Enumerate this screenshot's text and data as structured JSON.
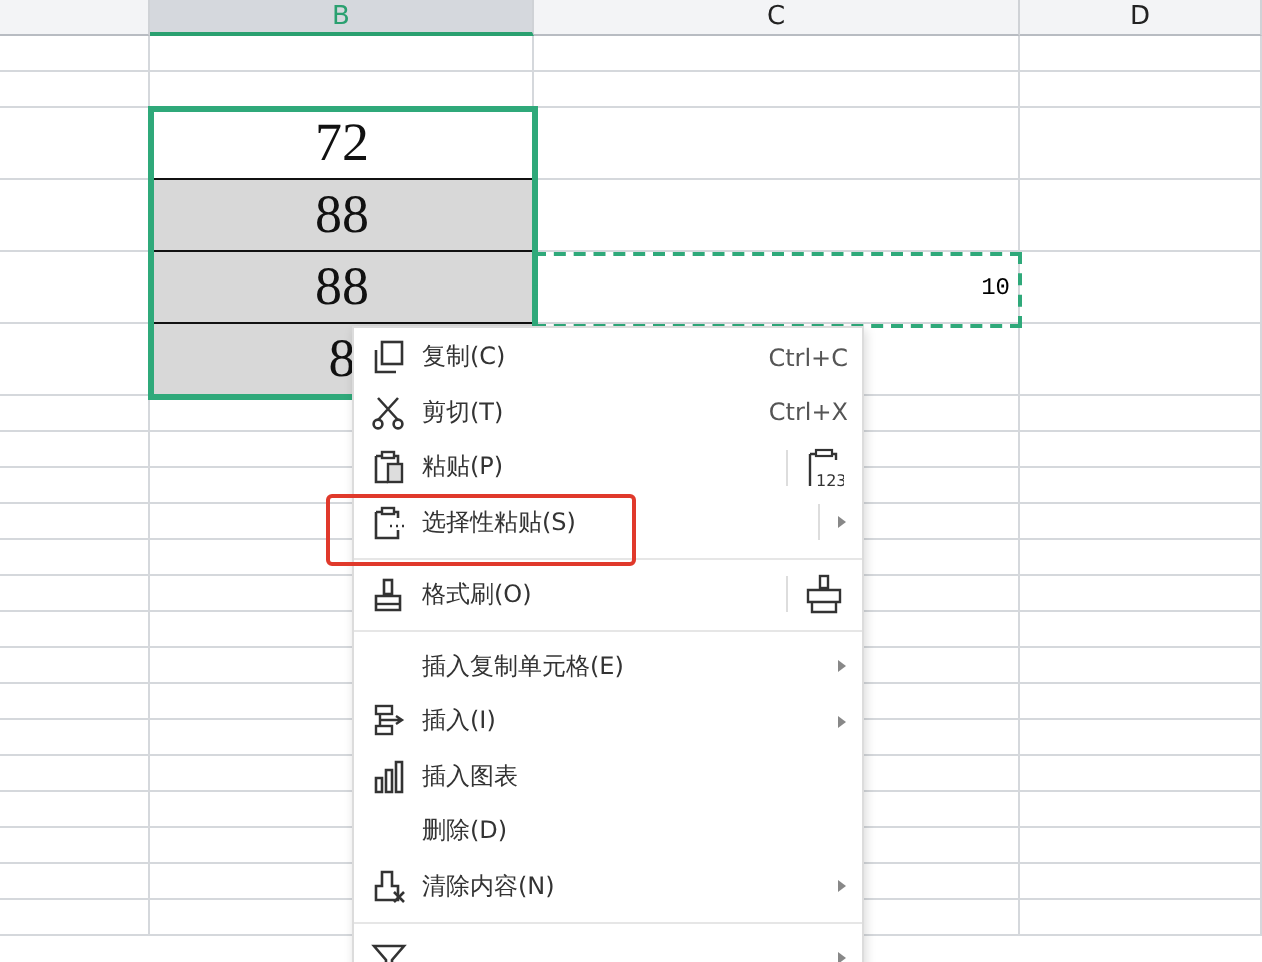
{
  "columns": [
    {
      "label": "B",
      "selected": true
    },
    {
      "label": "C",
      "selected": false
    },
    {
      "label": "D",
      "selected": false
    }
  ],
  "cells": [
    {
      "value": "72",
      "shaded": false
    },
    {
      "value": "88",
      "shaded": true
    },
    {
      "value": "88",
      "shaded": true
    },
    {
      "value": "8",
      "shaded": true
    }
  ],
  "copied_cell": {
    "value": "10"
  },
  "context_menu": {
    "items": [
      {
        "kind": "command",
        "label": "复制(C)",
        "shortcut": "Ctrl+C"
      },
      {
        "kind": "command",
        "label": "剪切(T)",
        "shortcut": "Ctrl+X"
      },
      {
        "kind": "split",
        "label": "粘贴(P)",
        "side_text": "123"
      },
      {
        "kind": "split-submenu",
        "label": "选择性粘贴(S)",
        "annotated": true
      },
      {
        "kind": "separator"
      },
      {
        "kind": "split",
        "label": "格式刷(O)"
      },
      {
        "kind": "separator"
      },
      {
        "kind": "submenu",
        "label": "插入复制单元格(E)"
      },
      {
        "kind": "submenu",
        "label": "插入(I)"
      },
      {
        "kind": "command",
        "label": "插入图表"
      },
      {
        "kind": "command",
        "label": "删除(D)"
      },
      {
        "kind": "submenu",
        "label": "清除内容(N)"
      },
      {
        "kind": "separator"
      },
      {
        "kind": "submenu"
      }
    ]
  }
}
